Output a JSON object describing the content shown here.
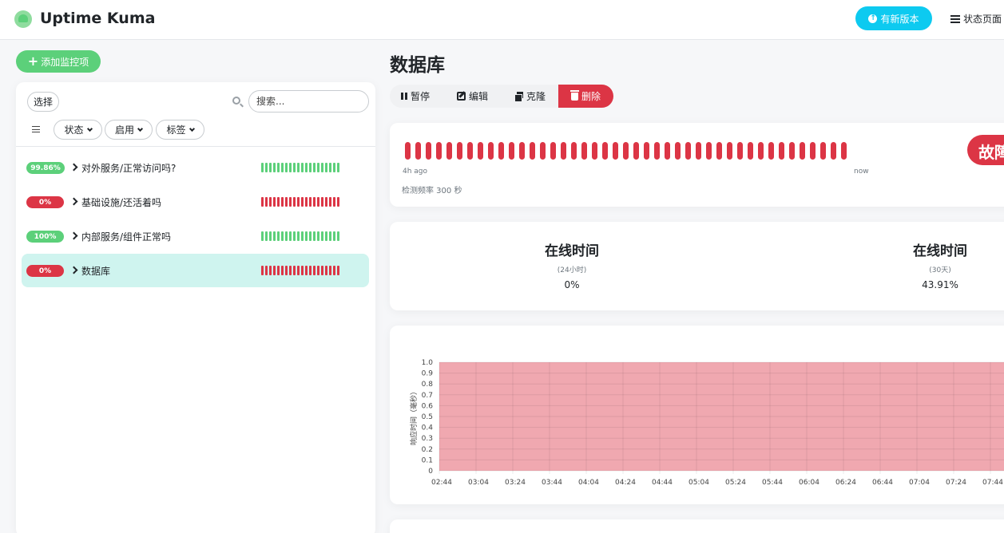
{
  "header": {
    "app_title": "Uptime Kuma",
    "update_label": "有新版本",
    "status_page_label": "状态页面"
  },
  "sidebar": {
    "add_monitor_label": "添加监控项",
    "select_label": "选择",
    "search_placeholder": "搜索...",
    "filters": {
      "status": "状态",
      "active": "启用",
      "tags": "标签"
    },
    "monitors": [
      {
        "badge": "99.86%",
        "status": "up",
        "name": "对外服务/正常访问吗?",
        "beats": "up"
      },
      {
        "badge": "0%",
        "status": "down",
        "name": "基础设施/还活着吗",
        "beats": "down"
      },
      {
        "badge": "100%",
        "status": "up",
        "name": "内部服务/组件正常吗",
        "beats": "up"
      },
      {
        "badge": "0%",
        "status": "down",
        "name": "数据库",
        "beats": "down",
        "selected": true
      }
    ]
  },
  "detail": {
    "title": "数据库",
    "actions": {
      "pause": "暂停",
      "edit": "编辑",
      "clone": "克隆",
      "delete": "删除"
    },
    "heartbeat": {
      "start_label": "4h ago",
      "end_label": "now",
      "check_interval_label": "检测频率 300 秒",
      "status_label": "故障",
      "count": 48
    },
    "stats": [
      {
        "title": "在线时间",
        "period": "(24小时)",
        "value": "0%"
      },
      {
        "title": "在线时间",
        "period": "(30天)",
        "value": "43.91%"
      }
    ]
  },
  "colors": {
    "up": "#5cd07a",
    "down": "#dc3545",
    "info": "#0dcaf0",
    "selected_bg": "#cff4ef",
    "chart_fill": "#f0a8b0"
  },
  "chart_data": {
    "type": "area",
    "ylabel": "响应时间（毫秒）",
    "ylim": [
      0,
      1
    ],
    "y_ticks": [
      "1.0",
      "0.9",
      "0.8",
      "0.7",
      "0.6",
      "0.5",
      "0.4",
      "0.3",
      "0.2",
      "0.1",
      "0"
    ],
    "x_ticks": [
      "02:44",
      "03:04",
      "03:24",
      "03:44",
      "04:04",
      "04:24",
      "04:44",
      "05:04",
      "05:24",
      "05:44",
      "06:04",
      "06:24",
      "06:44",
      "07:04",
      "07:24",
      "07:44"
    ],
    "series": [
      {
        "values": [
          1,
          1,
          1,
          1,
          1,
          1,
          1,
          1,
          1,
          1,
          1,
          1,
          1,
          1,
          1,
          1
        ]
      }
    ],
    "grid": true
  }
}
